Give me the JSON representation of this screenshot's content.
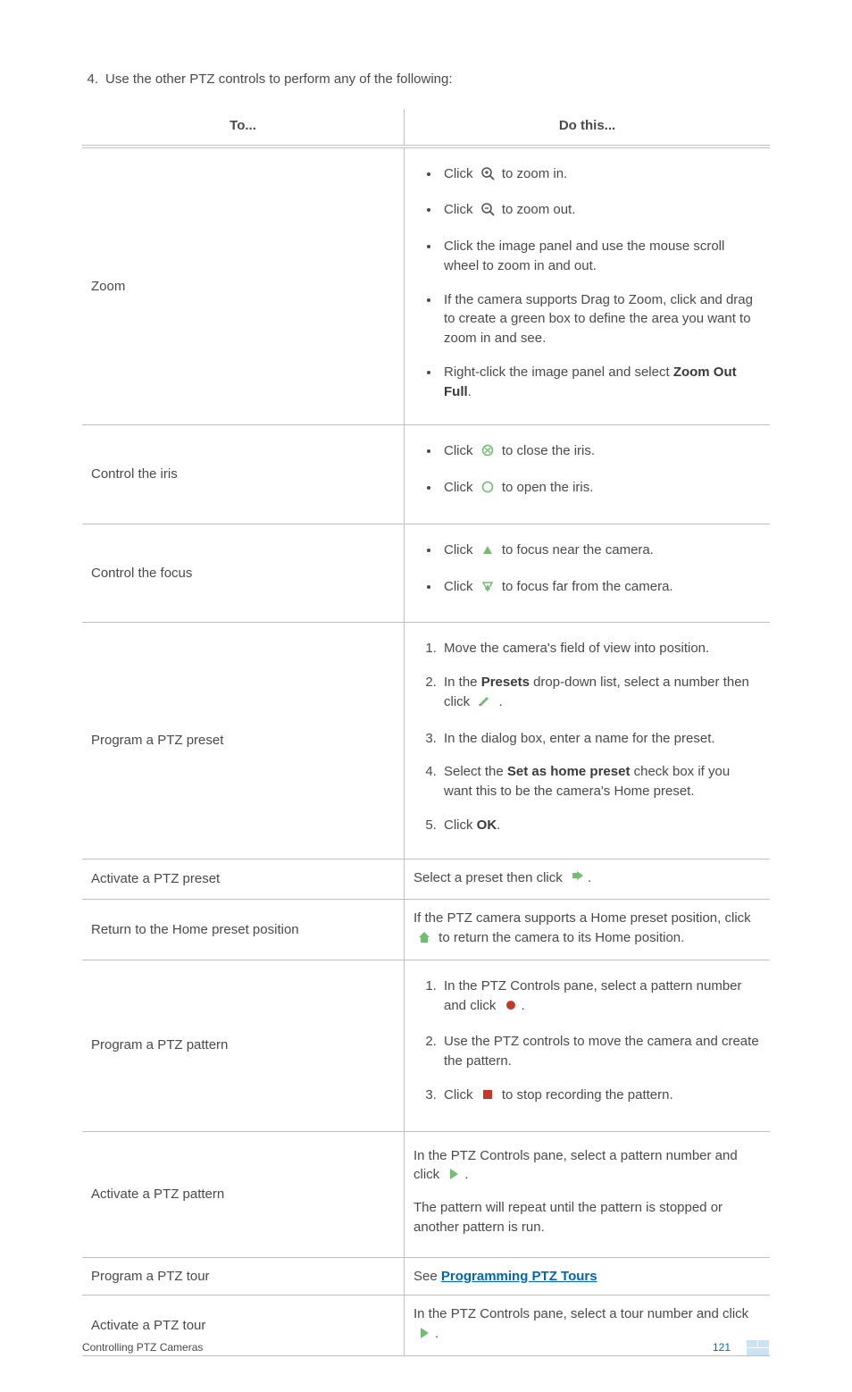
{
  "intro": {
    "number": "4.",
    "text": "Use the other PTZ controls to perform any of the following:"
  },
  "table": {
    "headers": {
      "to": "To...",
      "dothis": "Do this..."
    },
    "zoom": {
      "title": "Zoom",
      "b1a": "Click ",
      "b1b": " to zoom in.",
      "b2a": "Click ",
      "b2b": " to zoom out.",
      "b3": "Click the image panel and use the mouse scroll wheel to zoom in and out.",
      "b4": "If the camera supports Drag to Zoom, click and drag to create a green box to define the area you want to zoom in and see.",
      "b5a": "Right-click the image panel and select ",
      "b5b": "Zoom Out Full",
      "b5c": "."
    },
    "iris": {
      "title": "Control the iris",
      "b1a": "Click ",
      "b1b": " to close the iris.",
      "b2a": "Click ",
      "b2b": " to open the iris."
    },
    "focus": {
      "title": "Control the focus",
      "b1a": "Click ",
      "b1b": " to focus near the camera.",
      "b2a": "Click ",
      "b2b": " to focus far from the camera."
    },
    "presetProg": {
      "title": "Program a PTZ preset",
      "s1": "Move the camera's field of view into position.",
      "s2a": "In the ",
      "s2b": "Presets",
      "s2c": " drop-down list, select a number then click ",
      "s2d": " .",
      "s3": "In the dialog box, enter a name for the preset.",
      "s4a": "Select the ",
      "s4b": "Set as home preset",
      "s4c": " check box if you want this to be the camera's Home preset.",
      "s5a": "Click ",
      "s5b": "OK",
      "s5c": "."
    },
    "presetAct": {
      "title": "Activate a PTZ preset",
      "a": "Select a preset then click ",
      "b": "."
    },
    "home": {
      "title": "Return to the Home preset position",
      "a": "If the PTZ camera supports a Home preset position, click ",
      "b": " to return the camera to its Home position."
    },
    "patternProg": {
      "title": "Program a PTZ pattern",
      "s1a": "In the PTZ Controls pane, select a pattern number and click ",
      "s1b": ".",
      "s2": "Use the PTZ controls to move the camera and create the pattern.",
      "s3a": "Click ",
      "s3b": " to stop recording the pattern."
    },
    "patternAct": {
      "title": "Activate a PTZ pattern",
      "p1a": "In the PTZ Controls pane, select a pattern number and click ",
      "p1b": ".",
      "p2": "The pattern will repeat until the pattern is stopped or another pattern is run."
    },
    "tourProg": {
      "title": "Program a PTZ tour",
      "a": "See ",
      "link": "Programming PTZ Tours"
    },
    "tourAct": {
      "title": "Activate a PTZ tour",
      "a": "In the PTZ Controls pane, select a tour number and click ",
      "b": "."
    }
  },
  "footer": {
    "left": "Controlling PTZ Cameras",
    "page": "121"
  }
}
